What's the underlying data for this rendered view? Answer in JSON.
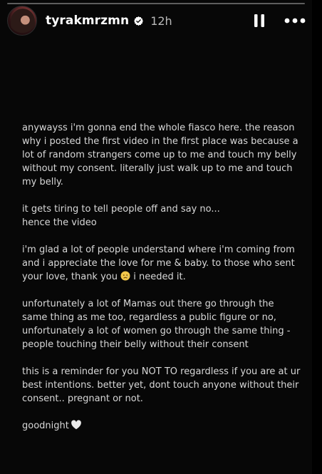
{
  "story": {
    "username": "tyrakmrzmn",
    "posted_ago": "12h",
    "progress_fraction": 0.0,
    "verified": true
  },
  "controls": {
    "pause_icon": "pause-icon",
    "more_icon": "more-options-icon"
  },
  "caption": {
    "paragraphs": [
      "anywayss i'm gonna end the whole fiasco here. the reason why i posted the first video in the first place was because a lot of random strangers come up to me and touch my belly without my consent. literally just walk up to me and touch my belly.",
      "it gets tiring to tell people off and say no...\nhence the video",
      "i'm glad a lot of people understand where i'm coming from and i appreciate the love for me & baby. to those who sent your love, thank you",
      "unfortunately a lot of Mamas out there go through the same thing as me too, regardless a public figure or no, unfortunately a lot of women go through the same thing - people touching their belly without their consent",
      "this is a reminder for you NOT TO regardless if you are at ur best intentions. better yet, dont touch anyone without their consent.. pregnant or not.",
      "goodnight"
    ],
    "paragraph3_tail": "i needed it."
  },
  "colors": {
    "background": "#070707",
    "text": "#d8d8d8",
    "timestamp": "#b9b9b9"
  }
}
